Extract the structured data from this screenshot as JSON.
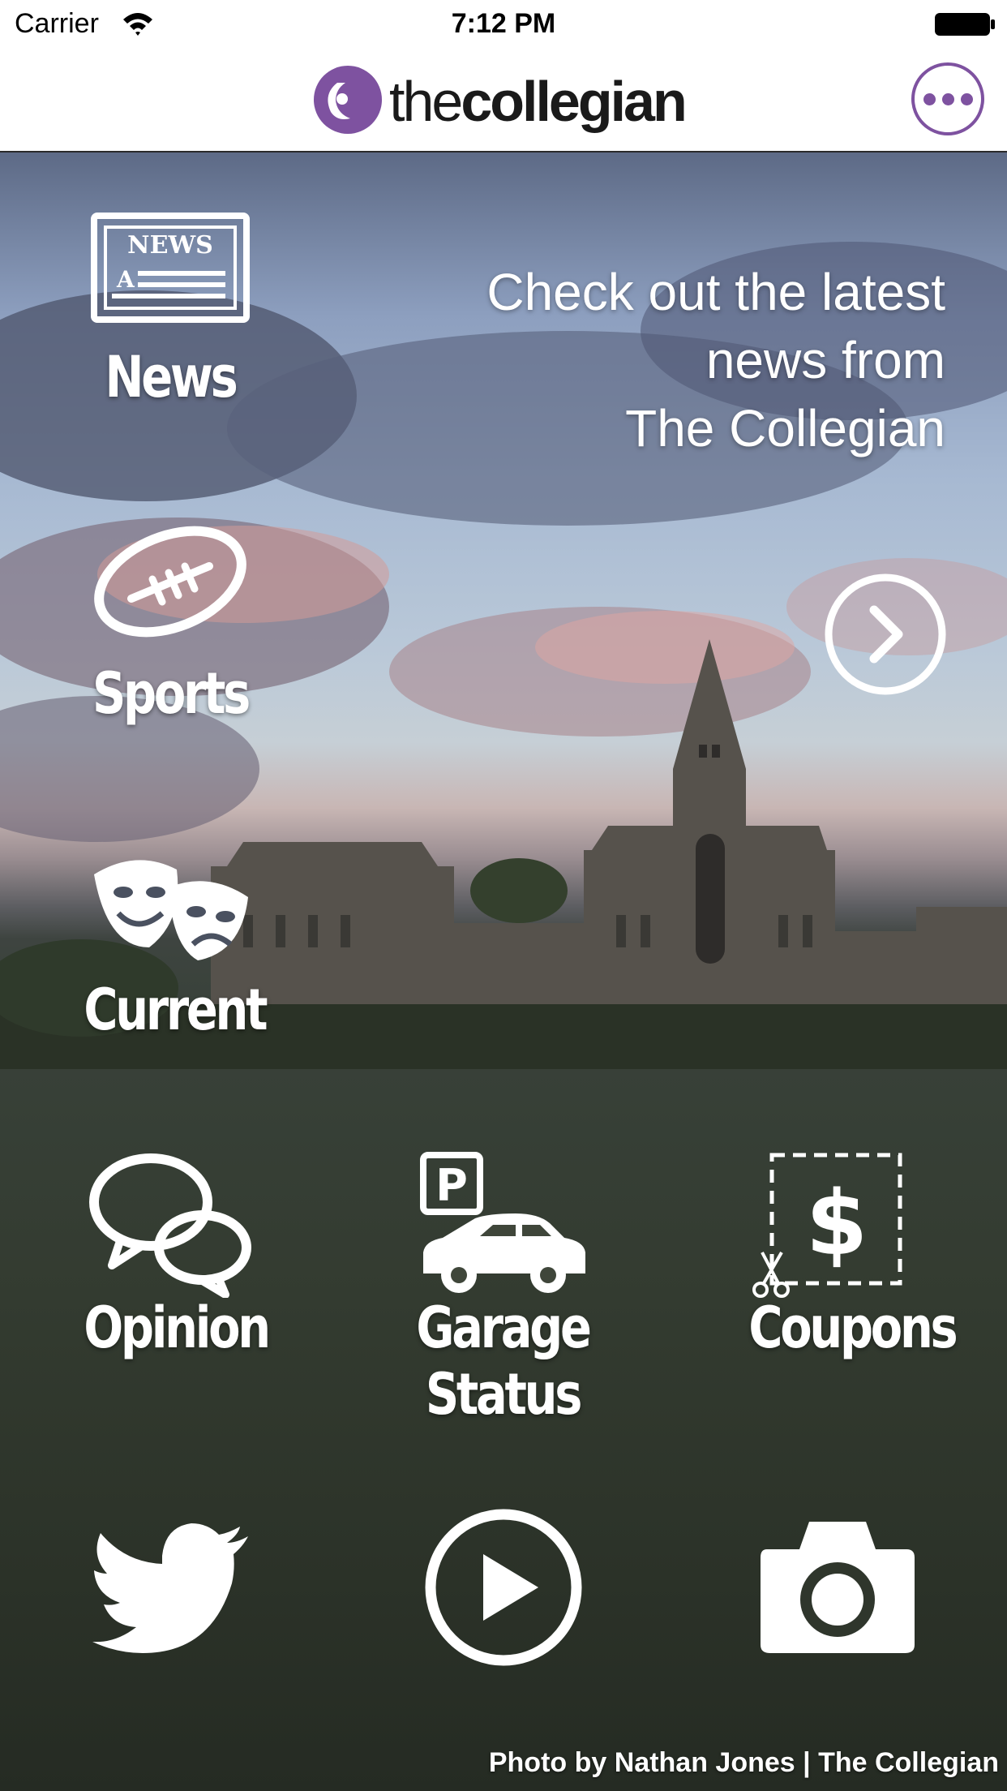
{
  "status_bar": {
    "carrier": "Carrier",
    "time": "7:12 PM",
    "icons": [
      "wifi-icon",
      "battery-icon"
    ]
  },
  "nav": {
    "logo_light": "the",
    "logo_bold": "collegian",
    "menu_icon": "more-dots-icon",
    "accent_color": "#7e52a0"
  },
  "headline": {
    "line1": "Check out the latest",
    "line2": "news from",
    "line3": "The Collegian",
    "arrow_icon": "chevron-right-circle-icon"
  },
  "sections": {
    "news": {
      "label": "News",
      "icon": "newspaper-icon",
      "icon_text": "NEWS",
      "icon_letter": "A"
    },
    "sports": {
      "label": "Sports",
      "icon": "football-icon"
    },
    "current": {
      "label": "Current",
      "icon": "theater-masks-icon"
    },
    "opinion": {
      "label": "Opinion",
      "icon": "speech-bubbles-icon"
    },
    "garage": {
      "label": "Garage Status",
      "icon": "parking-car-icon",
      "icon_text": "P"
    },
    "coupons": {
      "label": "Coupons",
      "icon": "coupon-scissors-icon",
      "icon_text": "$"
    }
  },
  "bottom_row": {
    "twitter": {
      "icon": "twitter-bird-icon"
    },
    "video": {
      "icon": "play-circle-icon"
    },
    "photos": {
      "icon": "camera-icon"
    }
  },
  "photo_credit": "Photo by  Nathan Jones | The Collegian"
}
